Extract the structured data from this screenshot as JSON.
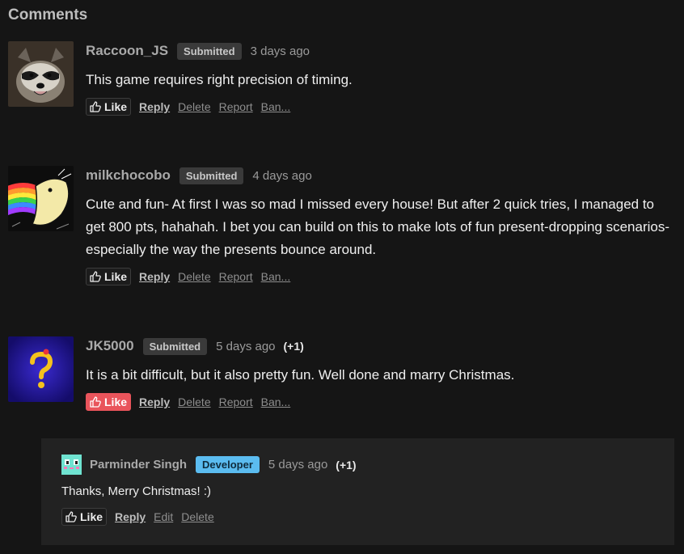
{
  "section": {
    "title": "Comments"
  },
  "comments": [
    {
      "username": "Raccoon_JS",
      "badge": "Submitted",
      "time": "3 days ago",
      "text": "This game requires right precision of timing.",
      "like_label": "Like",
      "reply_label": "Reply",
      "delete_label": "Delete",
      "report_label": "Report",
      "ban_label": "Ban..."
    },
    {
      "username": "milkchocobo",
      "badge": "Submitted",
      "time": "4 days ago",
      "text": "Cute and fun- At first I was so mad I missed every house! But after 2 quick tries, I managed to get 800 pts, hahahah. I bet you can build on this to make lots of fun present-dropping scenarios- especially the way the presents bounce around.",
      "like_label": "Like",
      "reply_label": "Reply",
      "delete_label": "Delete",
      "report_label": "Report",
      "ban_label": "Ban..."
    },
    {
      "username": "JK5000",
      "badge": "Submitted",
      "time": "5 days ago",
      "score": "(+1)",
      "text": "It is a bit difficult, but it also pretty fun. Well done and marry Christmas.",
      "like_label": "Like",
      "liked": true,
      "reply_label": "Reply",
      "delete_label": "Delete",
      "report_label": "Report",
      "ban_label": "Ban..."
    }
  ],
  "reply": {
    "username": "Parminder Singh",
    "badge": "Developer",
    "time": "5 days ago",
    "score": "(+1)",
    "text": "Thanks, Merry Christmas! :)",
    "like_label": "Like",
    "reply_label": "Reply",
    "edit_label": "Edit",
    "delete_label": "Delete"
  },
  "icons": {
    "like": "thumbs-up-icon"
  },
  "colors": {
    "background": "#151515",
    "liked": "#e9545b",
    "developer_badge": "#5bbcf0"
  }
}
